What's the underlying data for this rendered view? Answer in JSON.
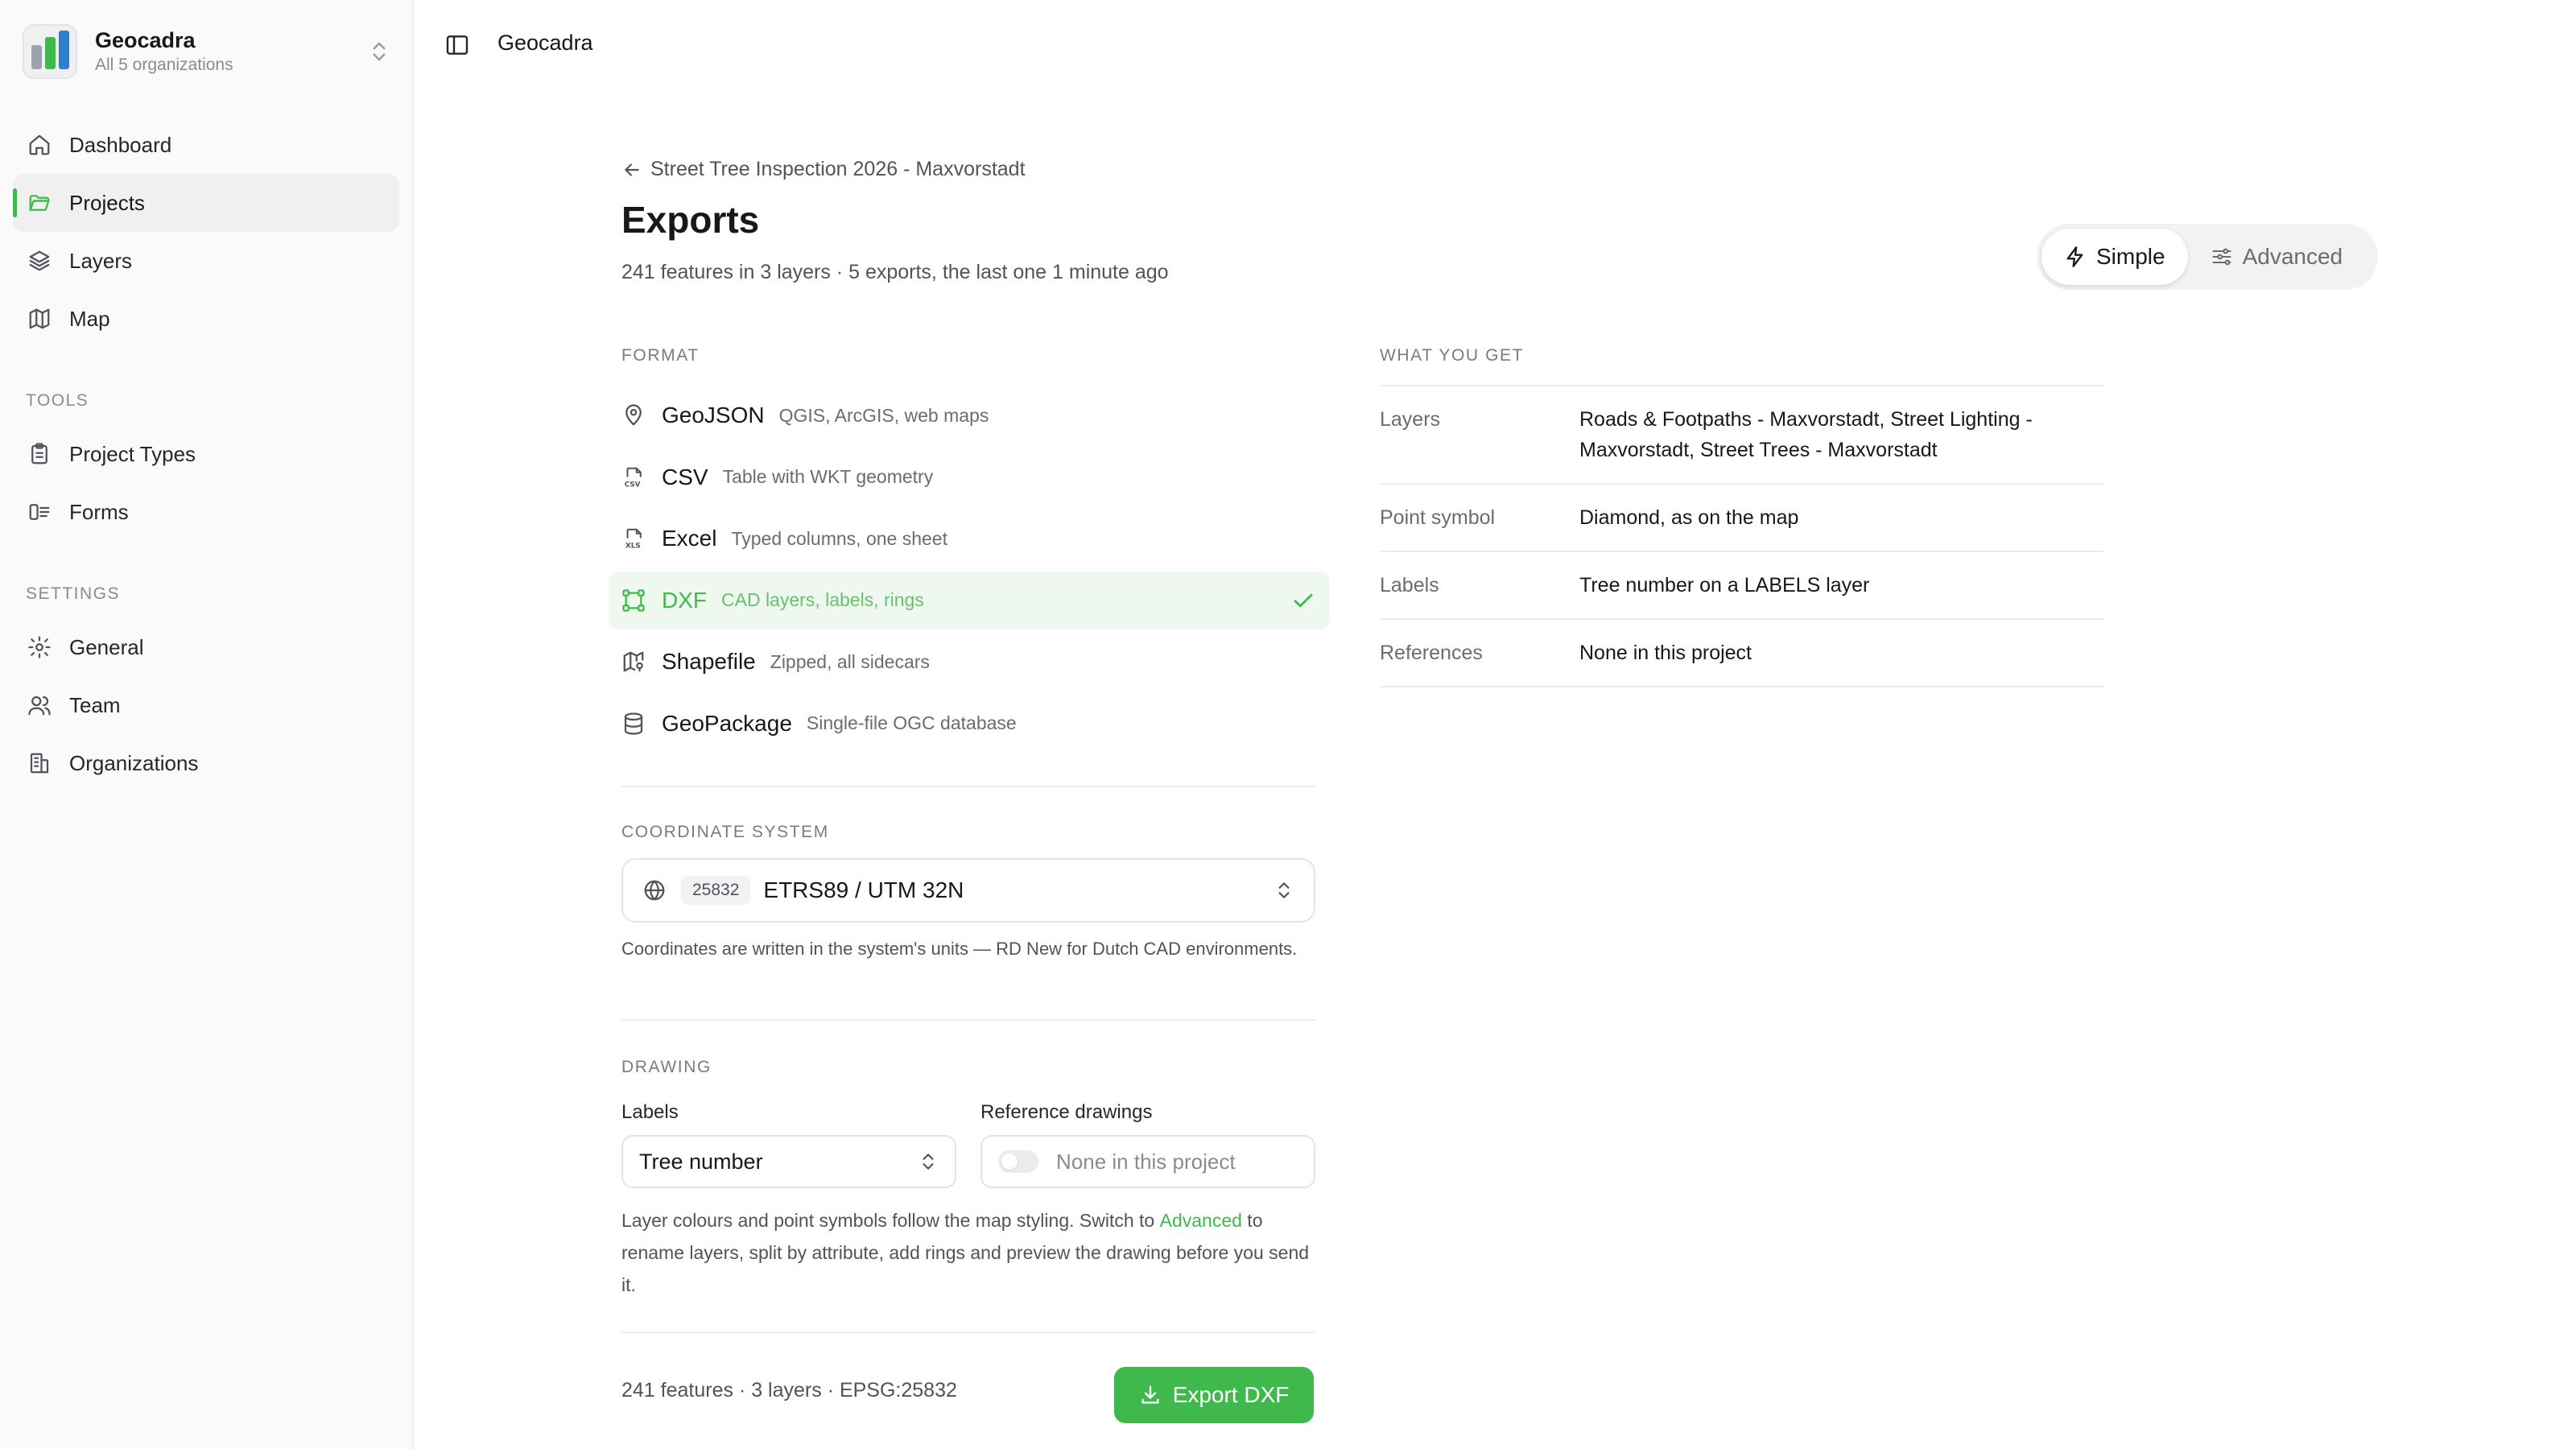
{
  "org": {
    "name": "Geocadra",
    "subtitle": "All 5 organizations"
  },
  "sidebar": {
    "nav": [
      {
        "label": "Dashboard",
        "icon": "home-icon"
      },
      {
        "label": "Projects",
        "icon": "folder-icon"
      },
      {
        "label": "Layers",
        "icon": "layers-icon"
      },
      {
        "label": "Map",
        "icon": "map-icon"
      }
    ],
    "tools_label": "TOOLS",
    "tools": [
      {
        "label": "Project Types",
        "icon": "clipboard-icon"
      },
      {
        "label": "Forms",
        "icon": "form-icon"
      }
    ],
    "settings_label": "SETTINGS",
    "settings": [
      {
        "label": "General",
        "icon": "gear-icon"
      },
      {
        "label": "Team",
        "icon": "users-icon"
      },
      {
        "label": "Organizations",
        "icon": "building-icon"
      }
    ]
  },
  "topbar": {
    "title": "Geocadra"
  },
  "page": {
    "back_label": "Street Tree Inspection 2026 - Maxvorstadt",
    "title": "Exports",
    "subtitle": "241 features in 3 layers · 5 exports, the last one 1 minute ago"
  },
  "mode": {
    "simple": "Simple",
    "advanced": "Advanced",
    "selected": "Simple"
  },
  "format": {
    "label": "FORMAT",
    "selected": "DXF",
    "options": [
      {
        "name": "GeoJSON",
        "desc": "QGIS, ArcGIS, web maps",
        "icon": "map-pin-icon"
      },
      {
        "name": "CSV",
        "desc": "Table with WKT geometry",
        "icon": "csv-file-icon"
      },
      {
        "name": "Excel",
        "desc": "Typed columns, one sheet",
        "icon": "xls-file-icon"
      },
      {
        "name": "DXF",
        "desc": "CAD layers, labels, rings",
        "icon": "vector-square-icon"
      },
      {
        "name": "Shapefile",
        "desc": "Zipped, all sidecars",
        "icon": "map-fold-icon"
      },
      {
        "name": "GeoPackage",
        "desc": "Single-file OGC database",
        "icon": "database-icon"
      }
    ]
  },
  "coordinate": {
    "label": "COORDINATE SYSTEM",
    "code": "25832",
    "name": "ETRS89 / UTM 32N",
    "help": "Coordinates are written in the system's units — RD New for Dutch CAD environments."
  },
  "drawing": {
    "label": "DRAWING",
    "labels_label": "Labels",
    "labels_value": "Tree number",
    "reference_label": "Reference drawings",
    "reference_value": "None in this project",
    "help_before": "Layer colours and point symbols follow the map styling. Switch to ",
    "help_link": "Advanced",
    "help_after": " to rename layers, split by attribute, add rings and preview the drawing before you send it."
  },
  "footer": {
    "summary": "241 features · 3 layers · EPSG:25832",
    "export_label": "Export DXF"
  },
  "what_you_get": {
    "label": "WHAT YOU GET",
    "rows": [
      {
        "key": "Layers",
        "value": "Roads & Footpaths - Maxvorstadt, Street Lighting - Maxvorstadt, Street Trees - Maxvorstadt"
      },
      {
        "key": "Point symbol",
        "value": "Diamond, as on the map"
      },
      {
        "key": "Labels",
        "value": "Tree number on a LABELS layer"
      },
      {
        "key": "References",
        "value": "None in this project"
      }
    ]
  },
  "colors": {
    "accent": "#3fb94b",
    "selected_bg": "#eef8ef",
    "sidebar_bg": "#fafafa"
  }
}
